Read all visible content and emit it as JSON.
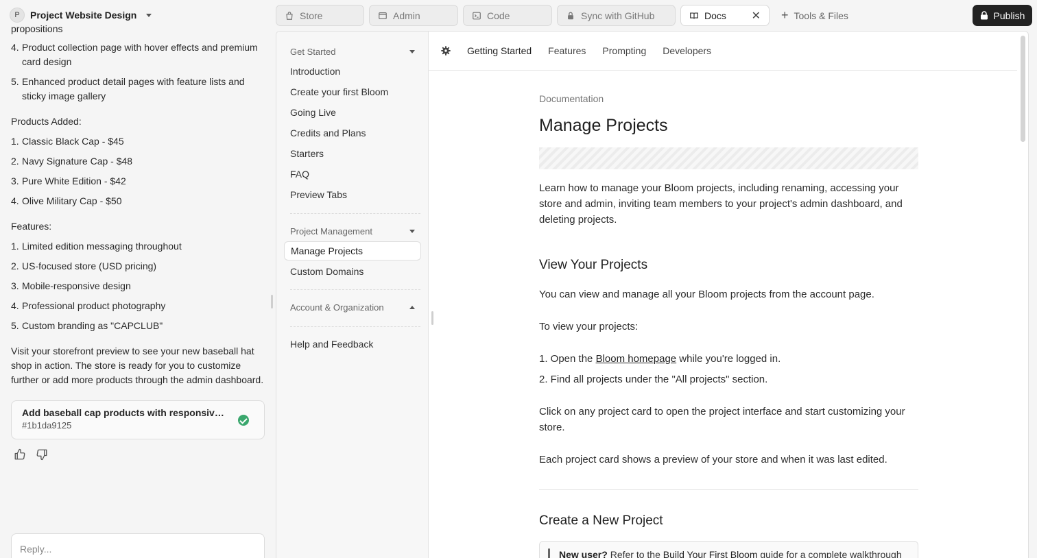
{
  "project": {
    "avatar": "P",
    "name": "Project Website Design"
  },
  "chat": {
    "cut_line": "propositions",
    "intro_items": [
      {
        "n": "4.",
        "text": "Product collection page with hover effects and premium card design"
      },
      {
        "n": "5.",
        "text": "Enhanced product detail pages with feature lists and sticky image gallery"
      }
    ],
    "products_heading": "Products Added:",
    "products": [
      {
        "n": "1.",
        "text": "Classic Black Cap - $45"
      },
      {
        "n": "2.",
        "text": "Navy Signature Cap - $48"
      },
      {
        "n": "3.",
        "text": "Pure White Edition - $42"
      },
      {
        "n": "4.",
        "text": "Olive Military Cap - $50"
      }
    ],
    "features_heading": "Features:",
    "features": [
      {
        "n": "1.",
        "text": "Limited edition messaging throughout"
      },
      {
        "n": "2.",
        "text": "US-focused store (USD pricing)"
      },
      {
        "n": "3.",
        "text": "Mobile-responsive design"
      },
      {
        "n": "4.",
        "text": "Professional product photography"
      },
      {
        "n": "5.",
        "text": "Custom branding as \"CAPCLUB\""
      }
    ],
    "closing": "Visit your storefront preview to see your new baseball hat shop in action. The store is ready for you to customize further or add more products through the admin dashboard.",
    "commit": {
      "title": "Add baseball cap products with responsive g...",
      "hash": "#1b1da9125"
    },
    "reply_placeholder": "Reply..."
  },
  "topbar": {
    "tabs": [
      {
        "label": "Store",
        "icon": "bag-icon"
      },
      {
        "label": "Admin",
        "icon": "window-icon"
      },
      {
        "label": "Code",
        "icon": "terminal-icon"
      },
      {
        "label": "Sync with GitHub",
        "icon": "lock-icon"
      },
      {
        "label": "Docs",
        "icon": "book-icon"
      }
    ],
    "tools_label": "Tools & Files",
    "publish_label": "Publish"
  },
  "docs_nav": {
    "groups": [
      {
        "label": "Get Started",
        "expanded": true,
        "items": [
          "Introduction",
          "Create your first Bloom",
          "Going Live",
          "Credits and Plans",
          "Starters",
          "FAQ",
          "Preview Tabs"
        ]
      },
      {
        "label": "Project Management",
        "expanded": true,
        "items": [
          "Manage Projects",
          "Custom Domains"
        ]
      },
      {
        "label": "Account & Organization",
        "expanded": false,
        "items": []
      }
    ],
    "active_item": "Manage Projects",
    "footer_item": "Help and Feedback"
  },
  "docs_header": {
    "tabs": [
      "Getting Started",
      "Features",
      "Prompting",
      "Developers"
    ],
    "active": "Getting Started"
  },
  "article": {
    "eyebrow": "Documentation",
    "title": "Manage Projects",
    "intro": "Learn how to manage your Bloom projects, including renaming, accessing your store and admin, inviting team members to your project's admin dashboard, and deleting projects.",
    "section1_title": "View Your Projects",
    "section1_p1": "You can view and manage all your Bloom projects from the account page.",
    "section1_p2": "To view your projects:",
    "step1_pre": "1. Open the ",
    "step1_link": "Bloom homepage",
    "step1_post": " while you're logged in.",
    "step2": "2. Find all projects under the \"All projects\" section.",
    "section1_p3": "Click on any project card to open the project interface and start customizing your store.",
    "section1_p4": "Each project card shows a preview of your store and when it was last edited.",
    "section2_title": "Create a New Project",
    "callout_bold": "New user?",
    "callout_pre": " Refer to the ",
    "callout_link": "Build Your First Bloom",
    "callout_post": " guide for a complete walkthrough of"
  },
  "colors": {
    "publish_bg": "#222222",
    "success": "#3aa76d"
  }
}
